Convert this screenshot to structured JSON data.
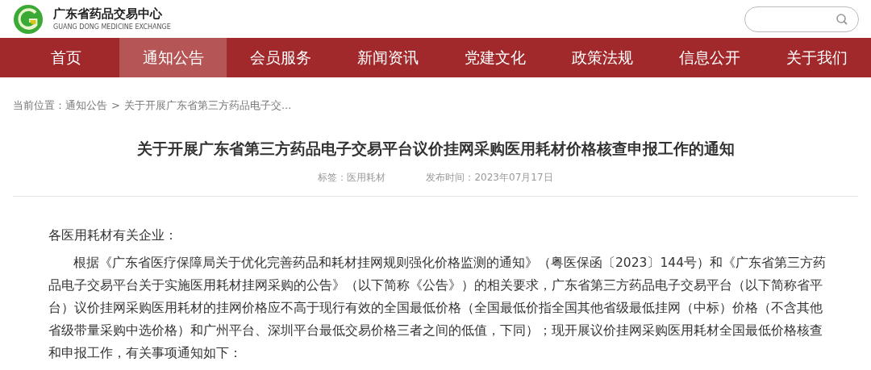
{
  "header": {
    "site_name": "广东省药品交易中心",
    "site_name_en": "GUANG DONG MEDICINE EXCHANGE"
  },
  "nav": [
    {
      "label": "首页",
      "selected": false
    },
    {
      "label": "通知公告",
      "selected": true
    },
    {
      "label": "会员服务",
      "selected": false
    },
    {
      "label": "新闻资讯",
      "selected": false
    },
    {
      "label": "党建文化",
      "selected": false
    },
    {
      "label": "政策法规",
      "selected": false
    },
    {
      "label": "信息公开",
      "selected": false
    },
    {
      "label": "关于我们",
      "selected": false
    }
  ],
  "breadcrumb": {
    "prefix": "当前位置：",
    "items": [
      "通知公告",
      "关于开展广东省第三方药品电子交..."
    ],
    "separator": ">"
  },
  "article": {
    "title": "关于开展广东省第三方药品电子交易平台议价挂网采购医用耗材价格核查申报工作的通知",
    "tag": "标签：医用耗材",
    "date": "发布时间：2023年07月17日",
    "greeting": "各医用耗材有关企业：",
    "paragraphs": [
      "根据《广东省医疗保障局关于优化完善药品和耗材挂网规则强化价格监测的通知》（粤医保函〔2023〕144号）和《广东省第三方药品电子交易平台关于实施医用耗材挂网采购的公告》（以下简称《公告》）的相关要求，广东省第三方药品电子交易平台（以下简称省平台）议价挂网采购医用耗材的挂网价格应不高于现行有效的全国最低价格（全国最低价指全国其他省级最低挂网（中标）价格（不含其他省级带量采购中选价格）和广州平台、深圳平台最低交易价格三者之间的低值，下同）；现开展议价挂网采购医用耗材全国最低价格核查和申报工作，有关事项通知如下："
    ]
  }
}
